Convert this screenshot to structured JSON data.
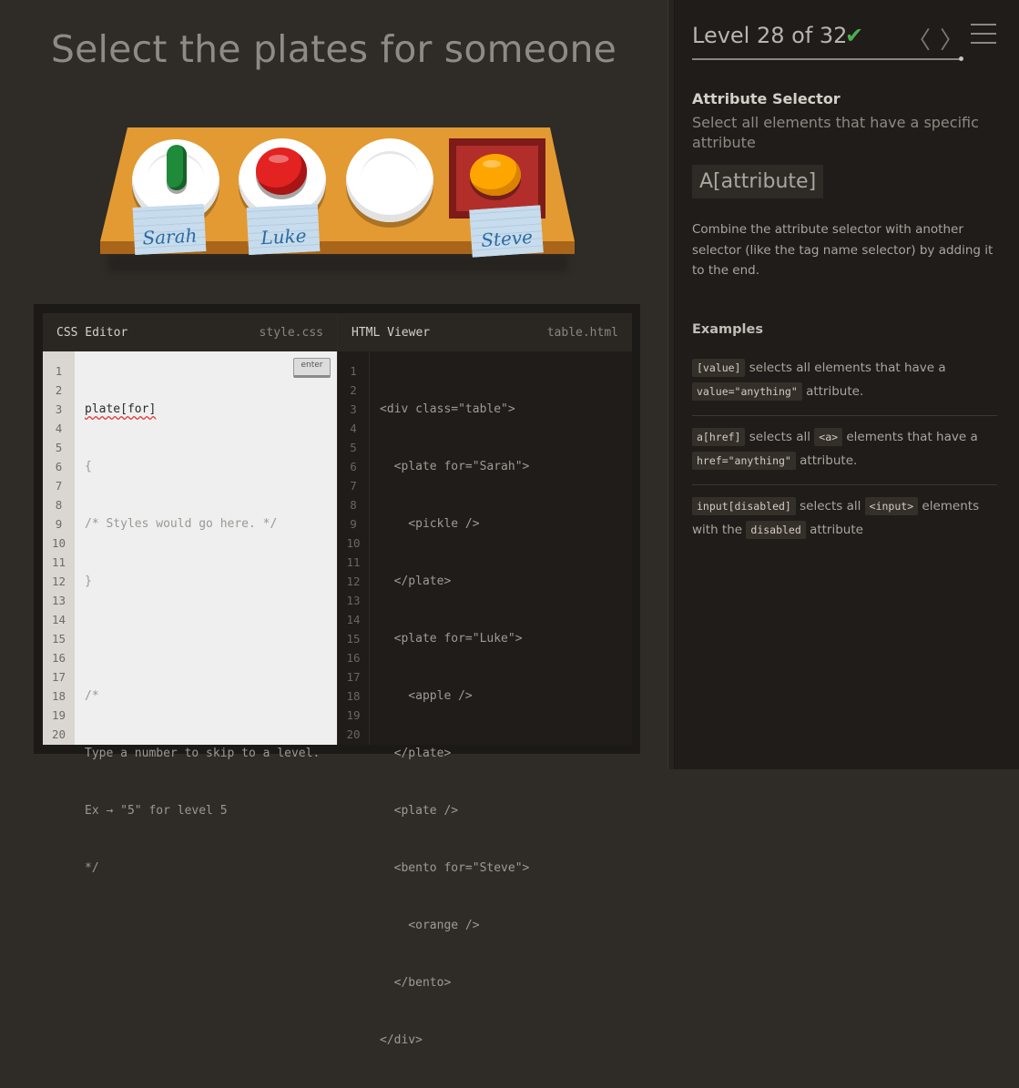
{
  "order": "Select the plates for someone",
  "table": {
    "names": [
      "Sarah",
      "Luke",
      "Steve"
    ]
  },
  "css_editor": {
    "title": "CSS Editor",
    "file": "style.css",
    "enter_label": "enter",
    "input_value": "plate[for]",
    "lines": [
      "{",
      "/* Styles would go here. */",
      "}",
      "",
      "/*",
      "Type a number to skip to a level.",
      "Ex → \"5\" for level 5",
      "*/"
    ]
  },
  "html_viewer": {
    "title": "HTML Viewer",
    "file": "table.html",
    "lines": [
      "<div class=\"table\">",
      "  <plate for=\"Sarah\">",
      "    <pickle />",
      "  </plate>",
      "  <plate for=\"Luke\">",
      "    <apple />",
      "  </plate>",
      "  <plate />",
      "  <bento for=\"Steve\">",
      "    <orange />",
      "  </bento>",
      "</div>"
    ]
  },
  "line_numbers": [
    "1",
    "2",
    "3",
    "4",
    "5",
    "6",
    "7",
    "8",
    "9",
    "10",
    "11",
    "12",
    "13",
    "14",
    "15",
    "16",
    "17",
    "18",
    "19",
    "20"
  ],
  "sidebar": {
    "level_text": "Level 28 of 32",
    "check": "✔",
    "prev": "〈",
    "next": "〉",
    "selector_name": "Attribute Selector",
    "title": "Select all elements that have a specific attribute",
    "syntax": "A[attribute]",
    "hint": "Combine the attribute selector with another selector (like the tag name selector) by adding it to the end.",
    "examples_title": "Examples",
    "examples": [
      {
        "code1": "[value]",
        "text1": " selects all elements that have a ",
        "code2": "value=\"anything\"",
        "text2": " attribute."
      },
      {
        "code1": "a[href]",
        "text1": " selects all ",
        "code2": "<a>",
        "text2": " elements that have a ",
        "code3": "href=\"anything\"",
        "text3": " attribute."
      },
      {
        "code1": "input[disabled]",
        "text1": " selects all ",
        "code2": "<input>",
        "text2": " elements with the ",
        "code3": "disabled",
        "text3": " attribute"
      }
    ]
  },
  "colors": {
    "background": "#2f2b27",
    "sidebar": "#1f1c19",
    "table": "#e39a32",
    "check": "#4cae4f"
  }
}
